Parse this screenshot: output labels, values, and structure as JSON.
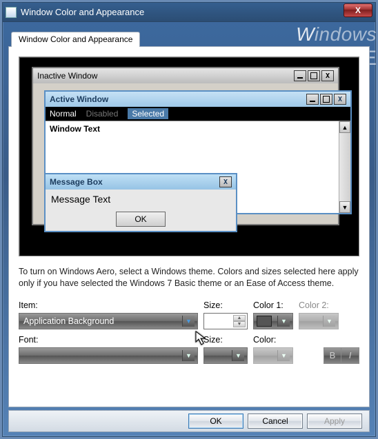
{
  "titlebar": {
    "title": "Window Color and Appearance",
    "close": "X"
  },
  "watermark": "Windows",
  "tab": {
    "label": "Window Color and Appearance"
  },
  "preview": {
    "inactive_title": "Inactive Window",
    "active_title": "Active Window",
    "menu_normal": "Normal",
    "menu_disabled": "Disabled",
    "menu_selected": "Selected",
    "window_text": "Window Text",
    "msgbox_title": "Message Box",
    "msgbox_text": "Message Text",
    "msgbox_ok": "OK"
  },
  "description": "To turn on Windows Aero, select a Windows theme.  Colors and sizes selected here apply only if you have selected the Windows 7 Basic theme or an Ease of Access theme.",
  "form": {
    "item_label": "Item:",
    "item_value": "Application Background",
    "size_label": "Size:",
    "size_value": "",
    "color1_label": "Color 1:",
    "color2_label": "Color 2:",
    "font_label": "Font:",
    "font_value": "",
    "font_size_label": "Size:",
    "font_size_value": "",
    "font_color_label": "Color:",
    "bold": "B",
    "italic": "I"
  },
  "buttons": {
    "ok": "OK",
    "cancel": "Cancel",
    "apply": "Apply"
  }
}
